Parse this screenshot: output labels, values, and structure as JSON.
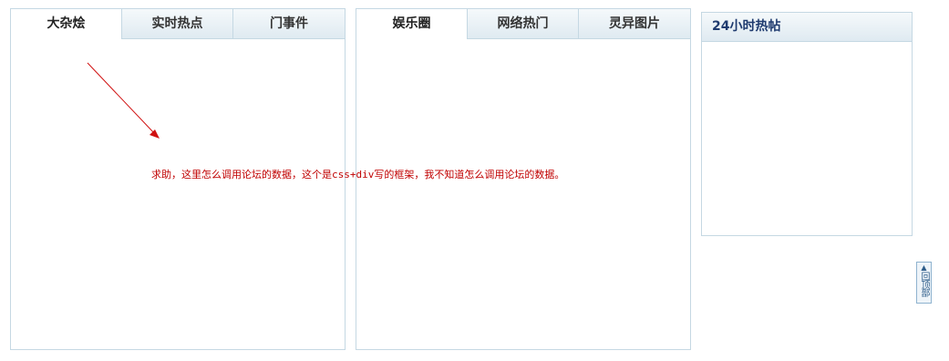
{
  "left_panel": {
    "tabs": [
      {
        "label": "大杂烩"
      },
      {
        "label": "实时热点"
      },
      {
        "label": "门事件"
      }
    ]
  },
  "middle_panel": {
    "tabs": [
      {
        "label": "娱乐圈"
      },
      {
        "label": "网络热门"
      },
      {
        "label": "灵异图片"
      }
    ]
  },
  "right_panel": {
    "title": "24小时热帖"
  },
  "annotation": {
    "text": "求助，这里怎么调用论坛的数据，这个是css+div写的框架，我不知道怎么调用论坛的数据。",
    "color": "#c00000"
  },
  "back_to_top": {
    "label": "回顶部",
    "icon": "triangle-up-icon"
  }
}
